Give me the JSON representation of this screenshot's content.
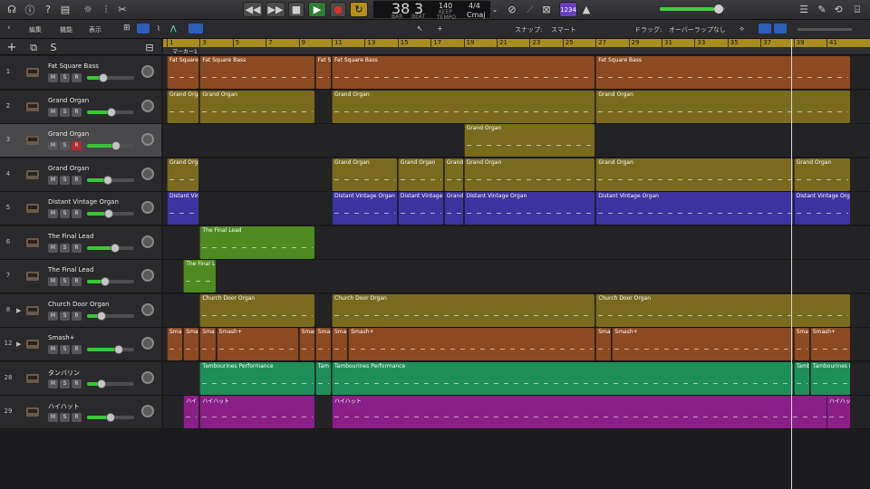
{
  "control_bar": {
    "lcd": {
      "bar": "38",
      "beat": "3",
      "bar_label": "BAR",
      "beat_label": "BEAT",
      "tempo": "140",
      "keep_label": "KEEP",
      "tempo_label": "TEMPO",
      "time_sig": "4/4",
      "key": "Cmaj"
    },
    "count_in": "1234"
  },
  "secondary": {
    "edit": "編集",
    "functions": "機能",
    "view": "表示",
    "snap_label": "スナップ:",
    "snap_value": "スマート",
    "drag_label": "ドラッグ:",
    "drag_value": "オーバーラップなし"
  },
  "marker": "マーカー1",
  "ruler": [
    "1",
    "3",
    "5",
    "7",
    "9",
    "11",
    "13",
    "15",
    "17",
    "19",
    "21",
    "23",
    "25",
    "27",
    "29",
    "31",
    "33",
    "35",
    "37",
    "39",
    "41"
  ],
  "tracks": [
    {
      "num": "1",
      "name": "Fat Square Bass",
      "rec": false,
      "disc": false,
      "vol": 0.32,
      "selected": false
    },
    {
      "num": "2",
      "name": "Grand Organ",
      "rec": false,
      "disc": false,
      "vol": 0.52,
      "selected": false
    },
    {
      "num": "3",
      "name": "Grand Organ",
      "rec": true,
      "disc": false,
      "vol": 0.65,
      "selected": true
    },
    {
      "num": "4",
      "name": "Grand Organ",
      "rec": false,
      "disc": false,
      "vol": 0.43,
      "selected": false
    },
    {
      "num": "5",
      "name": "Distant Vintage Organ",
      "rec": false,
      "disc": false,
      "vol": 0.45,
      "selected": false
    },
    {
      "num": "6",
      "name": "The Final Lead",
      "rec": false,
      "disc": false,
      "vol": 0.62,
      "selected": false
    },
    {
      "num": "7",
      "name": "The Final Lead",
      "rec": false,
      "disc": false,
      "vol": 0.36,
      "selected": false
    },
    {
      "num": "8",
      "name": "Church Door Organ",
      "rec": false,
      "disc": true,
      "vol": 0.25,
      "selected": false
    },
    {
      "num": "12",
      "name": "Smash+",
      "rec": false,
      "disc": true,
      "vol": 0.72,
      "selected": false
    },
    {
      "num": "28",
      "name": "タンバリン",
      "rec": false,
      "disc": false,
      "vol": 0.25,
      "selected": false
    },
    {
      "num": "29",
      "name": "ハイハット",
      "rec": false,
      "disc": false,
      "vol": 0.5,
      "selected": false
    }
  ],
  "regions": [
    [
      {
        "name": "Fat Square",
        "s": 1,
        "e": 3,
        "c": "#8c4a22"
      },
      {
        "name": "Fat Square Bass",
        "s": 3,
        "e": 10,
        "c": "#8c4a22"
      },
      {
        "name": "Fat S",
        "s": 10,
        "e": 11,
        "c": "#8c4a22"
      },
      {
        "name": "Fat Square Bass",
        "s": 11,
        "e": 27,
        "c": "#8c4a22"
      },
      {
        "name": "Fat Square Bass",
        "s": 27,
        "e": 43,
        "c": "#8c4a22"
      }
    ],
    [
      {
        "name": "Grand Orga",
        "s": 1,
        "e": 3,
        "c": "#7a6a1e"
      },
      {
        "name": "Grand Organ",
        "s": 3,
        "e": 10,
        "c": "#7a6a1e"
      },
      {
        "name": "Grand Organ",
        "s": 11,
        "e": 27,
        "c": "#7a6a1e"
      },
      {
        "name": "Grand Organ",
        "s": 27,
        "e": 43,
        "c": "#7a6a1e"
      }
    ],
    [
      {
        "name": "Grand Organ",
        "s": 19,
        "e": 27,
        "c": "#7a6a1e"
      }
    ],
    [
      {
        "name": "Grand Orga",
        "s": 1,
        "e": 3,
        "c": "#7a6a1e"
      },
      {
        "name": "Grand Organ",
        "s": 11,
        "e": 15,
        "c": "#7a6a1e"
      },
      {
        "name": "Grand Organ",
        "s": 15,
        "e": 17.8,
        "c": "#7a6a1e"
      },
      {
        "name": "Grand",
        "s": 17.8,
        "e": 19,
        "c": "#7a6a1e"
      },
      {
        "name": "Grand Organ",
        "s": 19,
        "e": 27,
        "c": "#7a6a1e"
      },
      {
        "name": "Grand Organ",
        "s": 27,
        "e": 39,
        "c": "#7a6a1e"
      },
      {
        "name": "Grand Organ",
        "s": 39,
        "e": 43,
        "c": "#7a6a1e"
      }
    ],
    [
      {
        "name": "Distant Vint",
        "s": 1,
        "e": 3,
        "c": "#3d34a0"
      },
      {
        "name": "Distant Vintage Organ",
        "s": 11,
        "e": 15,
        "c": "#3d34a0"
      },
      {
        "name": "Distant Vintage",
        "s": 15,
        "e": 17.8,
        "c": "#3d34a0"
      },
      {
        "name": "Grand",
        "s": 17.8,
        "e": 19,
        "c": "#3d34a0"
      },
      {
        "name": "Distant Vintage Organ",
        "s": 19,
        "e": 27,
        "c": "#3d34a0"
      },
      {
        "name": "Distant Vintage Organ",
        "s": 27,
        "e": 39,
        "c": "#3d34a0"
      },
      {
        "name": "Distant Vintage Orga",
        "s": 39,
        "e": 43,
        "c": "#3d34a0"
      }
    ],
    [
      {
        "name": "The Final Lead",
        "s": 3,
        "e": 10,
        "c": "#4e8a20"
      }
    ],
    [
      {
        "name": "The Final L",
        "s": 2,
        "e": 4,
        "c": "#4e8a20"
      }
    ],
    [
      {
        "name": "Church Door Organ",
        "s": 3,
        "e": 10,
        "c": "#7a6a1e"
      },
      {
        "name": "Church Door Organ",
        "s": 11,
        "e": 27,
        "c": "#7a6a1e"
      },
      {
        "name": "Church Door Organ",
        "s": 27,
        "e": 43,
        "c": "#7a6a1e"
      }
    ],
    [
      {
        "name": "Sma",
        "s": 1,
        "e": 2,
        "c": "#8c4a22"
      },
      {
        "name": "Smas",
        "s": 2,
        "e": 3,
        "c": "#8c4a22"
      },
      {
        "name": "Sma",
        "s": 3,
        "e": 4,
        "c": "#8c4a22"
      },
      {
        "name": "Smash+",
        "s": 4,
        "e": 9,
        "c": "#8c4a22"
      },
      {
        "name": "Smas",
        "s": 9,
        "e": 10,
        "c": "#8c4a22"
      },
      {
        "name": "Sma",
        "s": 10,
        "e": 11,
        "c": "#8c4a22"
      },
      {
        "name": "Sma",
        "s": 11,
        "e": 12,
        "c": "#8c4a22"
      },
      {
        "name": "Smash+",
        "s": 12,
        "e": 27,
        "c": "#8c4a22"
      },
      {
        "name": "Sma",
        "s": 27,
        "e": 28,
        "c": "#8c4a22"
      },
      {
        "name": "Smash+",
        "s": 28,
        "e": 39,
        "c": "#8c4a22"
      },
      {
        "name": "Sma",
        "s": 39,
        "e": 40,
        "c": "#8c4a22"
      },
      {
        "name": "Smash+",
        "s": 40,
        "e": 43,
        "c": "#8c4a22"
      }
    ],
    [
      {
        "name": "Tambourines Performance",
        "s": 3,
        "e": 10,
        "c": "#1f8f5a"
      },
      {
        "name": "Tam",
        "s": 10,
        "e": 11,
        "c": "#1f8f5a"
      },
      {
        "name": "Tambourines Performance",
        "s": 11,
        "e": 39,
        "c": "#1f8f5a"
      },
      {
        "name": "Tamb",
        "s": 39,
        "e": 40,
        "c": "#1f8f5a"
      },
      {
        "name": "Tambourines Perf",
        "s": 40,
        "e": 43,
        "c": "#1f8f5a"
      }
    ],
    [
      {
        "name": "ハイ",
        "s": 2,
        "e": 3,
        "c": "#8a1f88"
      },
      {
        "name": "ハイハット",
        "s": 3,
        "e": 10,
        "c": "#8a1f88"
      },
      {
        "name": "ハイハット",
        "s": 11,
        "e": 43,
        "c": "#8a1f88"
      },
      {
        "name": "ハイハット",
        "s": 41,
        "e": 43,
        "c": "#8a1f88"
      }
    ]
  ]
}
